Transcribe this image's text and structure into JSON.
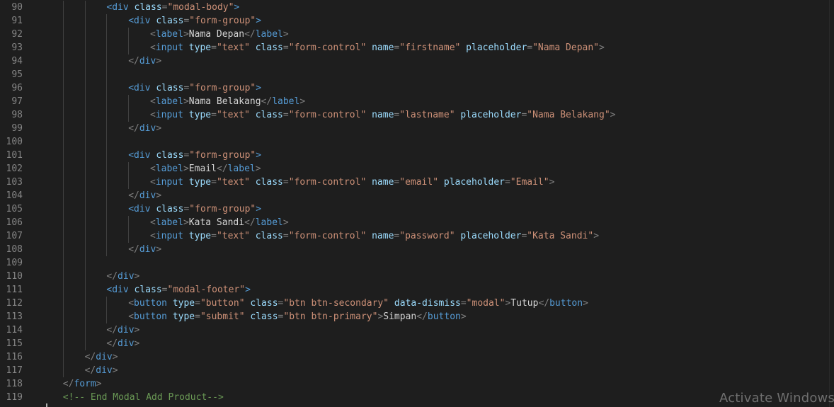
{
  "editor": {
    "lines": [
      {
        "num": "90",
        "indent": 3,
        "parts": [
          [
            "tag",
            "<div "
          ],
          [
            "attr",
            "class"
          ],
          [
            "pun",
            "="
          ],
          [
            "str",
            "\"modal-body\""
          ],
          [
            "tag",
            ">"
          ]
        ]
      },
      {
        "num": "91",
        "indent": 4,
        "parts": [
          [
            "tag",
            "<div "
          ],
          [
            "attr",
            "class"
          ],
          [
            "pun",
            "="
          ],
          [
            "str",
            "\"form-group\""
          ],
          [
            "tag",
            ">"
          ]
        ]
      },
      {
        "num": "92",
        "indent": 5,
        "parts": [
          [
            "pun",
            "<"
          ],
          [
            "tag",
            "label"
          ],
          [
            "pun",
            ">"
          ],
          [
            "txt",
            "Nama Depan"
          ],
          [
            "pun",
            "</"
          ],
          [
            "tag",
            "label"
          ],
          [
            "pun",
            ">"
          ]
        ]
      },
      {
        "num": "93",
        "indent": 5,
        "parts": [
          [
            "pun",
            "<"
          ],
          [
            "tag",
            "input "
          ],
          [
            "attr",
            "type"
          ],
          [
            "pun",
            "="
          ],
          [
            "str",
            "\"text\" "
          ],
          [
            "attr",
            "class"
          ],
          [
            "pun",
            "="
          ],
          [
            "str",
            "\"form-control\" "
          ],
          [
            "attr",
            "name"
          ],
          [
            "pun",
            "="
          ],
          [
            "str",
            "\"firstname\" "
          ],
          [
            "attr",
            "placeholder"
          ],
          [
            "pun",
            "="
          ],
          [
            "str",
            "\"Nama Depan\""
          ],
          [
            "pun",
            ">"
          ]
        ]
      },
      {
        "num": "94",
        "indent": 4,
        "parts": [
          [
            "pun",
            "</"
          ],
          [
            "tag",
            "div"
          ],
          [
            "pun",
            ">"
          ]
        ]
      },
      {
        "num": "95",
        "indent": 0,
        "parts": []
      },
      {
        "num": "96",
        "indent": 4,
        "parts": [
          [
            "tag",
            "<div "
          ],
          [
            "attr",
            "class"
          ],
          [
            "pun",
            "="
          ],
          [
            "str",
            "\"form-group\""
          ],
          [
            "tag",
            ">"
          ]
        ]
      },
      {
        "num": "97",
        "indent": 5,
        "parts": [
          [
            "pun",
            "<"
          ],
          [
            "tag",
            "label"
          ],
          [
            "pun",
            ">"
          ],
          [
            "txt",
            "Nama Belakang"
          ],
          [
            "pun",
            "</"
          ],
          [
            "tag",
            "label"
          ],
          [
            "pun",
            ">"
          ]
        ]
      },
      {
        "num": "98",
        "indent": 5,
        "parts": [
          [
            "pun",
            "<"
          ],
          [
            "tag",
            "input "
          ],
          [
            "attr",
            "type"
          ],
          [
            "pun",
            "="
          ],
          [
            "str",
            "\"text\" "
          ],
          [
            "attr",
            "class"
          ],
          [
            "pun",
            "="
          ],
          [
            "str",
            "\"form-control\" "
          ],
          [
            "attr",
            "name"
          ],
          [
            "pun",
            "="
          ],
          [
            "str",
            "\"lastname\" "
          ],
          [
            "attr",
            "placeholder"
          ],
          [
            "pun",
            "="
          ],
          [
            "str",
            "\"Nama Belakang\""
          ],
          [
            "pun",
            ">"
          ]
        ]
      },
      {
        "num": "99",
        "indent": 4,
        "parts": [
          [
            "pun",
            "</"
          ],
          [
            "tag",
            "div"
          ],
          [
            "pun",
            ">"
          ]
        ]
      },
      {
        "num": "100",
        "indent": 0,
        "parts": []
      },
      {
        "num": "101",
        "indent": 4,
        "parts": [
          [
            "tag",
            "<div "
          ],
          [
            "attr",
            "class"
          ],
          [
            "pun",
            "="
          ],
          [
            "str",
            "\"form-group\""
          ],
          [
            "tag",
            ">"
          ]
        ]
      },
      {
        "num": "102",
        "indent": 5,
        "parts": [
          [
            "pun",
            "<"
          ],
          [
            "tag",
            "label"
          ],
          [
            "pun",
            ">"
          ],
          [
            "txt",
            "Email"
          ],
          [
            "pun",
            "</"
          ],
          [
            "tag",
            "label"
          ],
          [
            "pun",
            ">"
          ]
        ]
      },
      {
        "num": "103",
        "indent": 5,
        "parts": [
          [
            "pun",
            "<"
          ],
          [
            "tag",
            "input "
          ],
          [
            "attr",
            "type"
          ],
          [
            "pun",
            "="
          ],
          [
            "str",
            "\"text\" "
          ],
          [
            "attr",
            "class"
          ],
          [
            "pun",
            "="
          ],
          [
            "str",
            "\"form-control\" "
          ],
          [
            "attr",
            "name"
          ],
          [
            "pun",
            "="
          ],
          [
            "str",
            "\"email\" "
          ],
          [
            "attr",
            "placeholder"
          ],
          [
            "pun",
            "="
          ],
          [
            "str",
            "\"Email\""
          ],
          [
            "pun",
            ">"
          ]
        ]
      },
      {
        "num": "104",
        "indent": 4,
        "parts": [
          [
            "pun",
            "</"
          ],
          [
            "tag",
            "div"
          ],
          [
            "pun",
            ">"
          ]
        ]
      },
      {
        "num": "105",
        "indent": 4,
        "parts": [
          [
            "tag",
            "<div "
          ],
          [
            "attr",
            "class"
          ],
          [
            "pun",
            "="
          ],
          [
            "str",
            "\"form-group\""
          ],
          [
            "tag",
            ">"
          ]
        ]
      },
      {
        "num": "106",
        "indent": 5,
        "parts": [
          [
            "pun",
            "<"
          ],
          [
            "tag",
            "label"
          ],
          [
            "pun",
            ">"
          ],
          [
            "txt",
            "Kata Sandi"
          ],
          [
            "pun",
            "</"
          ],
          [
            "tag",
            "label"
          ],
          [
            "pun",
            ">"
          ]
        ]
      },
      {
        "num": "107",
        "indent": 5,
        "parts": [
          [
            "pun",
            "<"
          ],
          [
            "tag",
            "input "
          ],
          [
            "attr",
            "type"
          ],
          [
            "pun",
            "="
          ],
          [
            "str",
            "\"text\" "
          ],
          [
            "attr",
            "class"
          ],
          [
            "pun",
            "="
          ],
          [
            "str",
            "\"form-control\" "
          ],
          [
            "attr",
            "name"
          ],
          [
            "pun",
            "="
          ],
          [
            "str",
            "\"password\" "
          ],
          [
            "attr",
            "placeholder"
          ],
          [
            "pun",
            "="
          ],
          [
            "str",
            "\"Kata Sandi\""
          ],
          [
            "pun",
            ">"
          ]
        ]
      },
      {
        "num": "108",
        "indent": 4,
        "parts": [
          [
            "pun",
            "</"
          ],
          [
            "tag",
            "div"
          ],
          [
            "pun",
            ">"
          ]
        ]
      },
      {
        "num": "109",
        "indent": 0,
        "parts": []
      },
      {
        "num": "110",
        "indent": 3,
        "parts": [
          [
            "pun",
            "</"
          ],
          [
            "tag",
            "div"
          ],
          [
            "pun",
            ">"
          ]
        ]
      },
      {
        "num": "111",
        "indent": 3,
        "parts": [
          [
            "tag",
            "<div "
          ],
          [
            "attr",
            "class"
          ],
          [
            "pun",
            "="
          ],
          [
            "str",
            "\"modal-footer\""
          ],
          [
            "tag",
            ">"
          ]
        ]
      },
      {
        "num": "112",
        "indent": 4,
        "parts": [
          [
            "pun",
            "<"
          ],
          [
            "tag",
            "button "
          ],
          [
            "attr",
            "type"
          ],
          [
            "pun",
            "="
          ],
          [
            "str",
            "\"button\" "
          ],
          [
            "attr",
            "class"
          ],
          [
            "pun",
            "="
          ],
          [
            "str",
            "\"btn btn-secondary\" "
          ],
          [
            "attr",
            "data-dismiss"
          ],
          [
            "pun",
            "="
          ],
          [
            "str",
            "\"modal\""
          ],
          [
            "pun",
            ">"
          ],
          [
            "txt",
            "Tutup"
          ],
          [
            "pun",
            "</"
          ],
          [
            "tag",
            "button"
          ],
          [
            "pun",
            ">"
          ]
        ]
      },
      {
        "num": "113",
        "indent": 4,
        "parts": [
          [
            "pun",
            "<"
          ],
          [
            "tag",
            "button "
          ],
          [
            "attr",
            "type"
          ],
          [
            "pun",
            "="
          ],
          [
            "str",
            "\"submit\" "
          ],
          [
            "attr",
            "class"
          ],
          [
            "pun",
            "="
          ],
          [
            "str",
            "\"btn btn-primary\""
          ],
          [
            "pun",
            ">"
          ],
          [
            "txt",
            "Simpan"
          ],
          [
            "pun",
            "</"
          ],
          [
            "tag",
            "button"
          ],
          [
            "pun",
            ">"
          ]
        ]
      },
      {
        "num": "114",
        "indent": 3,
        "parts": [
          [
            "pun",
            "</"
          ],
          [
            "tag",
            "div"
          ],
          [
            "pun",
            ">"
          ]
        ]
      },
      {
        "num": "115",
        "indent": 3,
        "parts": [
          [
            "pun",
            "</"
          ],
          [
            "tag",
            "div"
          ],
          [
            "pun",
            ">"
          ]
        ]
      },
      {
        "num": "116",
        "indent": 2,
        "parts": [
          [
            "pun",
            "</"
          ],
          [
            "tag",
            "div"
          ],
          [
            "pun",
            ">"
          ]
        ]
      },
      {
        "num": "117",
        "indent": 2,
        "parts": [
          [
            "pun",
            "</"
          ],
          [
            "tag",
            "div"
          ],
          [
            "pun",
            ">"
          ]
        ]
      },
      {
        "num": "118",
        "indent": 1,
        "parts": [
          [
            "pun",
            "</"
          ],
          [
            "tag",
            "form"
          ],
          [
            "pun",
            ">"
          ]
        ]
      },
      {
        "num": "119",
        "indent": 1,
        "parts": [
          [
            "com",
            "<!-- End Modal Add Product-->"
          ]
        ]
      }
    ]
  },
  "theme": {
    "background": "#1e1e1e",
    "tag": "#569cd6",
    "attribute": "#9cdcfe",
    "string": "#ce9178",
    "punctuation": "#808080",
    "text": "#d4d4d4",
    "comment": "#6a9955",
    "line_number": "#858585"
  },
  "watermark": {
    "text": "Activate Windows"
  }
}
